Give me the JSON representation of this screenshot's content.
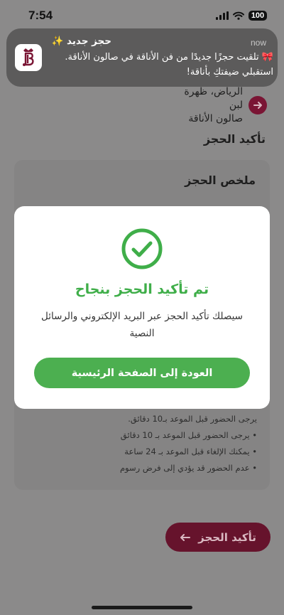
{
  "status_bar": {
    "time": "7:54",
    "battery": "100"
  },
  "notification": {
    "title": "حجز جديد ✨",
    "time": "now",
    "body": "🎀 تلقيت حجزًا جديدًا من فن الأناقة في صالون الأناقة. استقبلي ضيفتكِ بأناقة!",
    "app_icon": "salon-logo-icon",
    "accent_color": "#7a1534"
  },
  "background": {
    "location_line1": "الرياض، ظهرة لبن",
    "location_line2": "صالون الأناقة",
    "section_title": "تأكيد الحجز",
    "summary_title": "ملخص الحجز",
    "notes": [
      "يرجى الحضور قبل الموعد بـ10 دقائق.",
      "• يرجى الحضور قبل الموعد بـ 10 دقائق",
      "• يمكنك الإلغاء قبل الموعد بـ 24 ساعة",
      "• عدم الحضور قد يؤدي إلى فرض رسوم"
    ],
    "confirm_button": "تأكيد الحجز",
    "brand_color": "#7a1534"
  },
  "modal": {
    "title": "تم تأكيد الحجز بنجاح",
    "message": "سيصلك تأكيد الحجز عبر البريد الإلكتروني والرسائل النصية",
    "home_button": "العودة إلى الصفحة الرئيسية",
    "success_color": "#3fae49"
  }
}
